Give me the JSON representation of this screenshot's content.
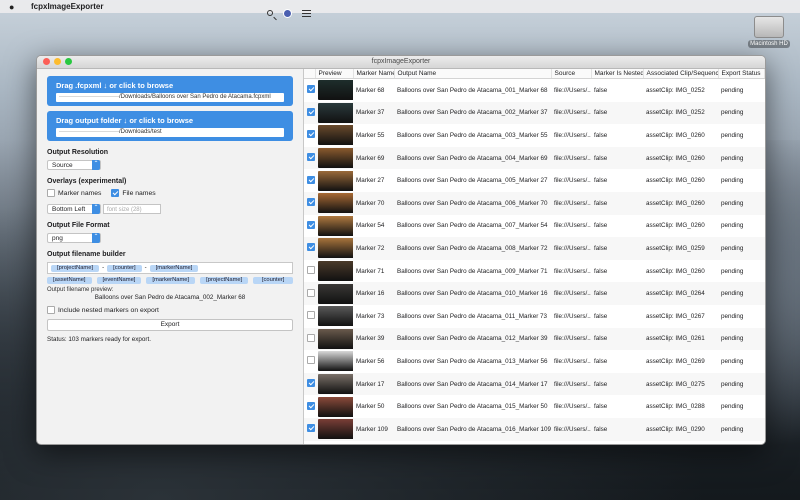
{
  "menubar": {
    "app_name": "fcpxImageExporter"
  },
  "desktop": {
    "drive_label": "Macintosh HD"
  },
  "window": {
    "title": "fcpxImageExporter"
  },
  "left": {
    "fcpxml_drop_title": "Drag .fcpxml ↓ or click to browse",
    "fcpxml_path": "······························/Downloads/Balloons over San Pedro de Atacama.fcpxml",
    "output_drop_title": "Drag output folder ↓ or click to browse",
    "output_path": "······························/Downloads/test",
    "resolution_heading": "Output Resolution",
    "resolution_value": "Source",
    "overlays_heading": "Overlays (experimental)",
    "overlay_marker_names": "Marker names",
    "overlay_file_names": "File names",
    "overlay_marker_checked": false,
    "overlay_file_checked": true,
    "position_value": "Bottom Left",
    "font_size_placeholder": "font size (28)",
    "format_heading": "Output File Format",
    "format_value": "png",
    "builder_heading": "Output filename builder",
    "builder_tokens": [
      "[projectName]",
      "-",
      "[counter]",
      "-",
      "[markerName]"
    ],
    "available_tokens": [
      "[assetName]",
      "[eventName]",
      "[markerName]",
      "[projectName]",
      "[counter]"
    ],
    "preview_label": "Output filename preview:",
    "preview_value": "Balloons over San Pedro de Atacama_002_Marker 68",
    "include_nested_label": "Include nested markers on export",
    "export_label": "Export",
    "status_text": "Status: 103 markers ready for export."
  },
  "table": {
    "headers": [
      "",
      "Preview",
      "Marker Name",
      "Output Name",
      "Source",
      "Marker Is Nested",
      "Associated Clip/Sequence",
      "Export Status"
    ],
    "rows": [
      {
        "checked": true,
        "thumb": "#1e2e2c",
        "marker": "Marker 68",
        "output": "Balloons over San Pedro de Atacama_001_Marker 68",
        "source": "file:///Users/...",
        "nested": "false",
        "clip": "assetClip: IMG_0252",
        "status": "pending"
      },
      {
        "checked": true,
        "thumb": "#2a3a3c",
        "marker": "Marker 37",
        "output": "Balloons over San Pedro de Atacama_002_Marker 37",
        "source": "file:///Users/...",
        "nested": "false",
        "clip": "assetClip: IMG_0252",
        "status": "pending"
      },
      {
        "checked": true,
        "thumb": "#6a4a2c",
        "marker": "Marker 55",
        "output": "Balloons over San Pedro de Atacama_003_Marker 55",
        "source": "file:///Users/...",
        "nested": "false",
        "clip": "assetClip: IMG_0260",
        "status": "pending"
      },
      {
        "checked": true,
        "thumb": "#8a5a2e",
        "marker": "Marker 69",
        "output": "Balloons over San Pedro de Atacama_004_Marker 69",
        "source": "file:///Users/...",
        "nested": "false",
        "clip": "assetClip: IMG_0260",
        "status": "pending"
      },
      {
        "checked": true,
        "thumb": "#9a6a3a",
        "marker": "Marker 27",
        "output": "Balloons over San Pedro de Atacama_005_Marker 27",
        "source": "file:///Users/...",
        "nested": "false",
        "clip": "assetClip: IMG_0260",
        "status": "pending"
      },
      {
        "checked": true,
        "thumb": "#a86a34",
        "marker": "Marker 70",
        "output": "Balloons over San Pedro de Atacama_006_Marker 70",
        "source": "file:///Users/...",
        "nested": "false",
        "clip": "assetClip: IMG_0260",
        "status": "pending"
      },
      {
        "checked": true,
        "thumb": "#b07a40",
        "marker": "Marker 54",
        "output": "Balloons over San Pedro de Atacama_007_Marker 54",
        "source": "file:///Users/...",
        "nested": "false",
        "clip": "assetClip: IMG_0260",
        "status": "pending"
      },
      {
        "checked": true,
        "thumb": "#a8743c",
        "marker": "Marker 72",
        "output": "Balloons over San Pedro de Atacama_008_Marker 72",
        "source": "file:///Users/...",
        "nested": "false",
        "clip": "assetClip: IMG_0259",
        "status": "pending"
      },
      {
        "checked": false,
        "thumb": "#4a3a2a",
        "marker": "Marker 71",
        "output": "Balloons over San Pedro de Atacama_009_Marker 71",
        "source": "file:///Users/...",
        "nested": "false",
        "clip": "assetClip: IMG_0260",
        "status": "pending"
      },
      {
        "checked": false,
        "thumb": "#3a3836",
        "marker": "Marker 16",
        "output": "Balloons over San Pedro de Atacama_010_Marker 16",
        "source": "file:///Users/...",
        "nested": "false",
        "clip": "assetClip: IMG_0264",
        "status": "pending"
      },
      {
        "checked": false,
        "thumb": "#5a5a5a",
        "marker": "Marker 73",
        "output": "Balloons over San Pedro de Atacama_011_Marker 73",
        "source": "file:///Users/...",
        "nested": "false",
        "clip": "assetClip: IMG_0267",
        "status": "pending"
      },
      {
        "checked": false,
        "thumb": "#6a5a4c",
        "marker": "Marker 39",
        "output": "Balloons over San Pedro de Atacama_012_Marker 39",
        "source": "file:///Users/...",
        "nested": "false",
        "clip": "assetClip: IMG_0261",
        "status": "pending"
      },
      {
        "checked": false,
        "thumb": "#d8d8d8",
        "marker": "Marker 56",
        "output": "Balloons over San Pedro de Atacama_013_Marker 56",
        "source": "file:///Users/...",
        "nested": "false",
        "clip": "assetClip: IMG_0269",
        "status": "pending"
      },
      {
        "checked": true,
        "thumb": "#7a7068",
        "marker": "Marker 17",
        "output": "Balloons over San Pedro de Atacama_014_Marker 17",
        "source": "file:///Users/...",
        "nested": "false",
        "clip": "assetClip: IMG_0275",
        "status": "pending"
      },
      {
        "checked": true,
        "thumb": "#8a4a3a",
        "marker": "Marker 50",
        "output": "Balloons over San Pedro de Atacama_015_Marker 50",
        "source": "file:///Users/...",
        "nested": "false",
        "clip": "assetClip: IMG_0288",
        "status": "pending"
      },
      {
        "checked": true,
        "thumb": "#7a3e36",
        "marker": "Marker 109",
        "output": "Balloons over San Pedro de Atacama_016_Marker 109",
        "source": "file:///Users/...",
        "nested": "false",
        "clip": "assetClip: IMG_0290",
        "status": "pending"
      }
    ]
  },
  "colors": {
    "accent": "#3e8ee3"
  }
}
